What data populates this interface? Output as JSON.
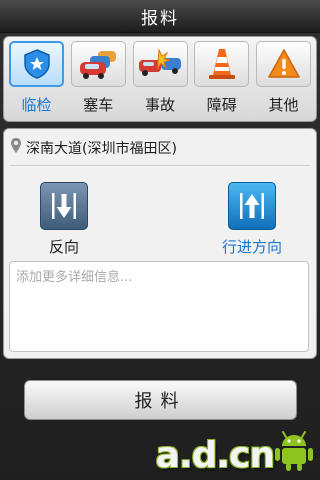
{
  "app": {
    "title": "报料"
  },
  "categories": [
    {
      "label": "临检",
      "icon": "police-shield-icon",
      "selected": true
    },
    {
      "label": "塞车",
      "icon": "traffic-jam-icon",
      "selected": false
    },
    {
      "label": "事故",
      "icon": "car-accident-icon",
      "selected": false
    },
    {
      "label": "障碍",
      "icon": "traffic-cone-icon",
      "selected": false
    },
    {
      "label": "其他",
      "icon": "warning-icon",
      "selected": false
    }
  ],
  "location": {
    "icon": "location-pin-icon",
    "text": "深南大道(深圳市福田区)"
  },
  "directions": {
    "reverse": {
      "label": "反向",
      "icon": "arrow-down-icon",
      "color": "#222222"
    },
    "forward": {
      "label": "行进方向",
      "icon": "arrow-up-icon",
      "color": "#1a77d2",
      "selected": true
    }
  },
  "details": {
    "placeholder": "添加更多详细信息...",
    "value": ""
  },
  "submit": {
    "label": "报料"
  },
  "watermark": {
    "text": "a.d.cn",
    "icon": "android-robot-icon"
  },
  "colors": {
    "accent": "#1a77d2",
    "selected_border": "#3d9be8"
  }
}
